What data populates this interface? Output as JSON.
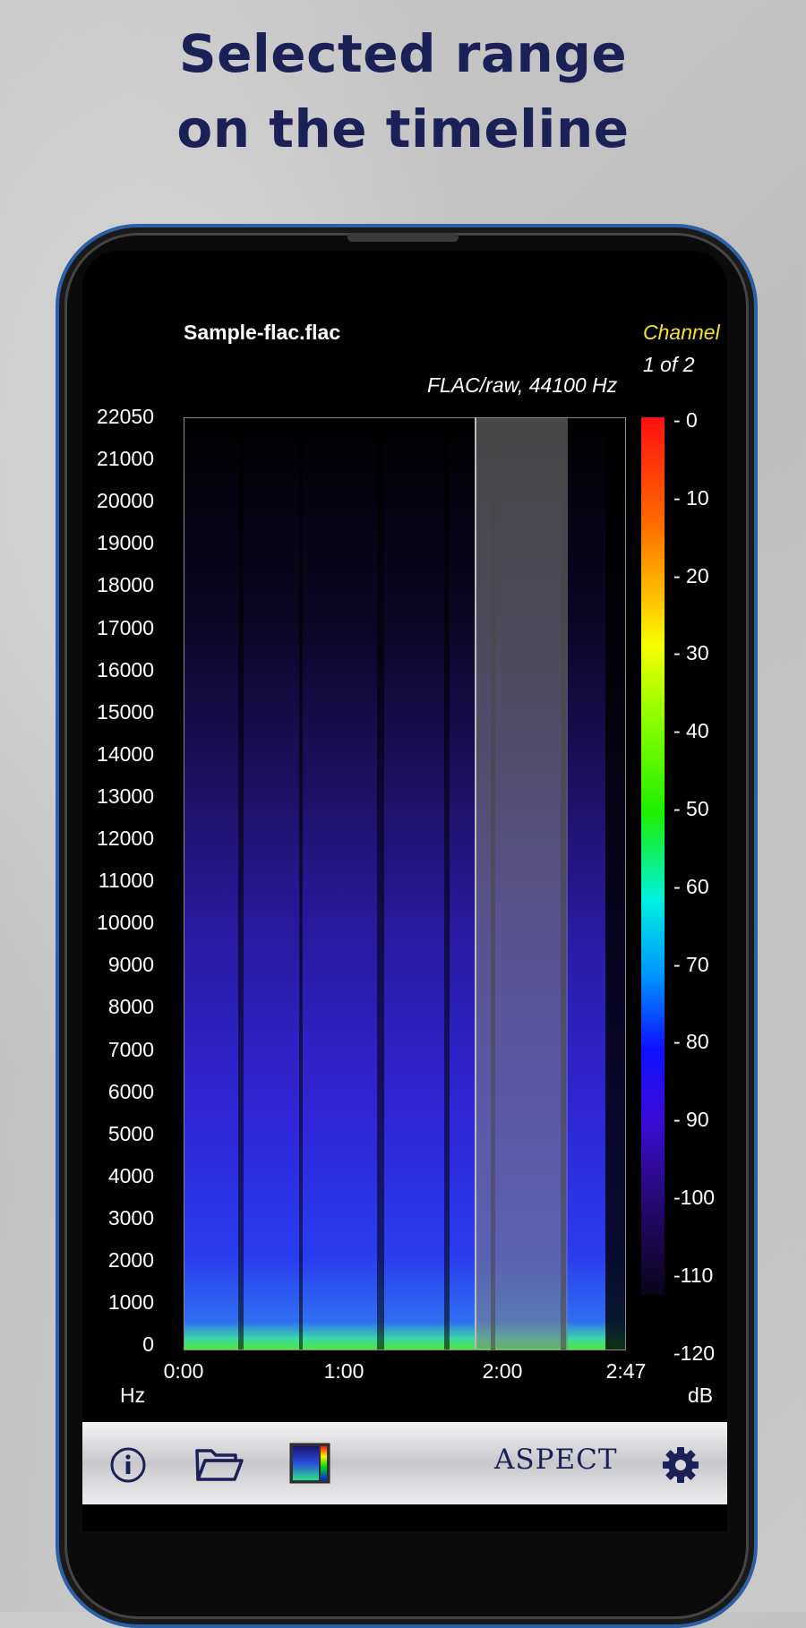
{
  "headline": [
    "Selected range",
    "on the timeline"
  ],
  "app": {
    "file_name": "Sample-flac.flac",
    "channel_label": "Channel",
    "channel_count": "1 of 2",
    "format_info": "FLAC/raw, 44100 Hz"
  },
  "frequency_axis": {
    "unit": "Hz",
    "ticks": [
      "22050",
      "21000",
      "20000",
      "19000",
      "18000",
      "17000",
      "16000",
      "15000",
      "14000",
      "13000",
      "12000",
      "11000",
      "10000",
      "9000",
      "8000",
      "7000",
      "6000",
      "5000",
      "4000",
      "3000",
      "2000",
      "1000",
      "0"
    ]
  },
  "time_axis": {
    "ticks": [
      "0:00",
      "1:00",
      "2:00",
      "2:47"
    ]
  },
  "db_scale": {
    "unit": "dB",
    "ticks": [
      "- 0",
      "- 10",
      "- 20",
      "- 30",
      "- 40",
      "- 50",
      "- 60",
      "- 70",
      "- 80",
      "- 90",
      "-100",
      "-110",
      "-120"
    ]
  },
  "toolbar": {
    "brand": "ASPECT",
    "icons": [
      "info-icon",
      "folder-open-icon",
      "spectrum-palette-icon",
      "gear-icon"
    ]
  },
  "colors": {
    "headline": "#1b2157",
    "channel": "#f2e22a",
    "phone_frame": "#2b5fa6"
  }
}
